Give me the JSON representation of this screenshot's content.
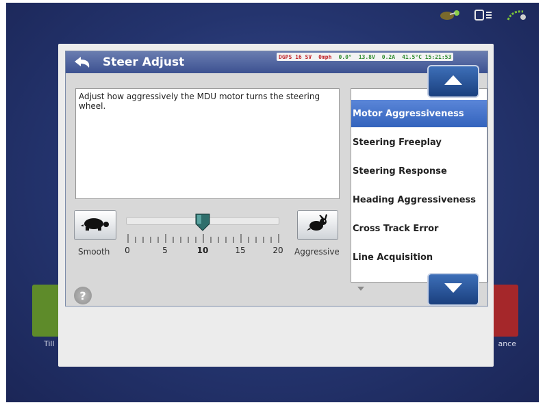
{
  "dialog": {
    "title": "Steer Adjust",
    "status": {
      "gps": "DGPS 16 SV",
      "speed": "0mph",
      "angle": "0.0°",
      "voltage": "13.8V",
      "current": "0.2A",
      "temp_time": "41.5°C 15:21:53"
    },
    "description": "Adjust how aggressively the MDU motor turns the steering wheel.",
    "slider": {
      "left_label": "Smooth",
      "right_label": "Aggressive",
      "ticks": [
        "0",
        "5",
        "10",
        "15",
        "20"
      ],
      "value": 10,
      "min": 0,
      "max": 20
    },
    "list": {
      "items": [
        "Motor Aggressiveness",
        "Steering Freeplay",
        "Steering Response",
        "Heading Aggressiveness",
        "Cross Track Error",
        "Line Acquisition"
      ],
      "selected_index": 0
    },
    "icons": {
      "back": "back-arrow-icon",
      "turtle": "turtle-icon",
      "rabbit": "rabbit-icon",
      "help": "help-icon",
      "up": "arrow-up-icon",
      "down": "arrow-down-icon"
    },
    "help_glyph": "?"
  },
  "background": {
    "left_tile_label": "Till",
    "right_tile_label": "ance"
  },
  "colors": {
    "titlebar": "#3c5191",
    "selected": "#3d6bc4",
    "status_red": "#c1272d",
    "status_green": "#2e8b2e"
  }
}
